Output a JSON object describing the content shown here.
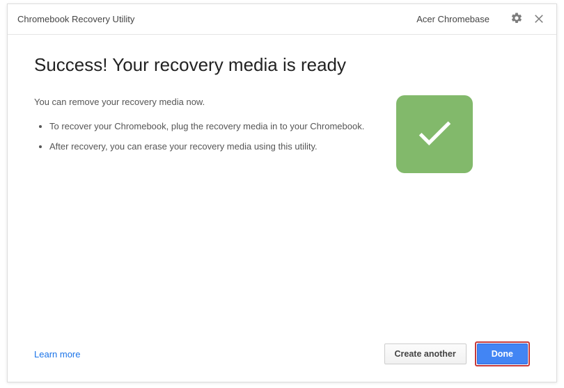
{
  "header": {
    "title": "Chromebook Recovery Utility",
    "device": "Acer Chromebase"
  },
  "main": {
    "heading": "Success! Your recovery media is ready",
    "intro": "You can remove your recovery media now.",
    "bullets": [
      "To recover your Chromebook, plug the recovery media in to your Chromebook.",
      "After recovery, you can erase your recovery media using this utility."
    ]
  },
  "footer": {
    "learn_more": "Learn more",
    "create_another": "Create another",
    "done": "Done"
  },
  "colors": {
    "success": "#82b96b",
    "primary": "#4285f4",
    "link": "#1a73e8"
  }
}
